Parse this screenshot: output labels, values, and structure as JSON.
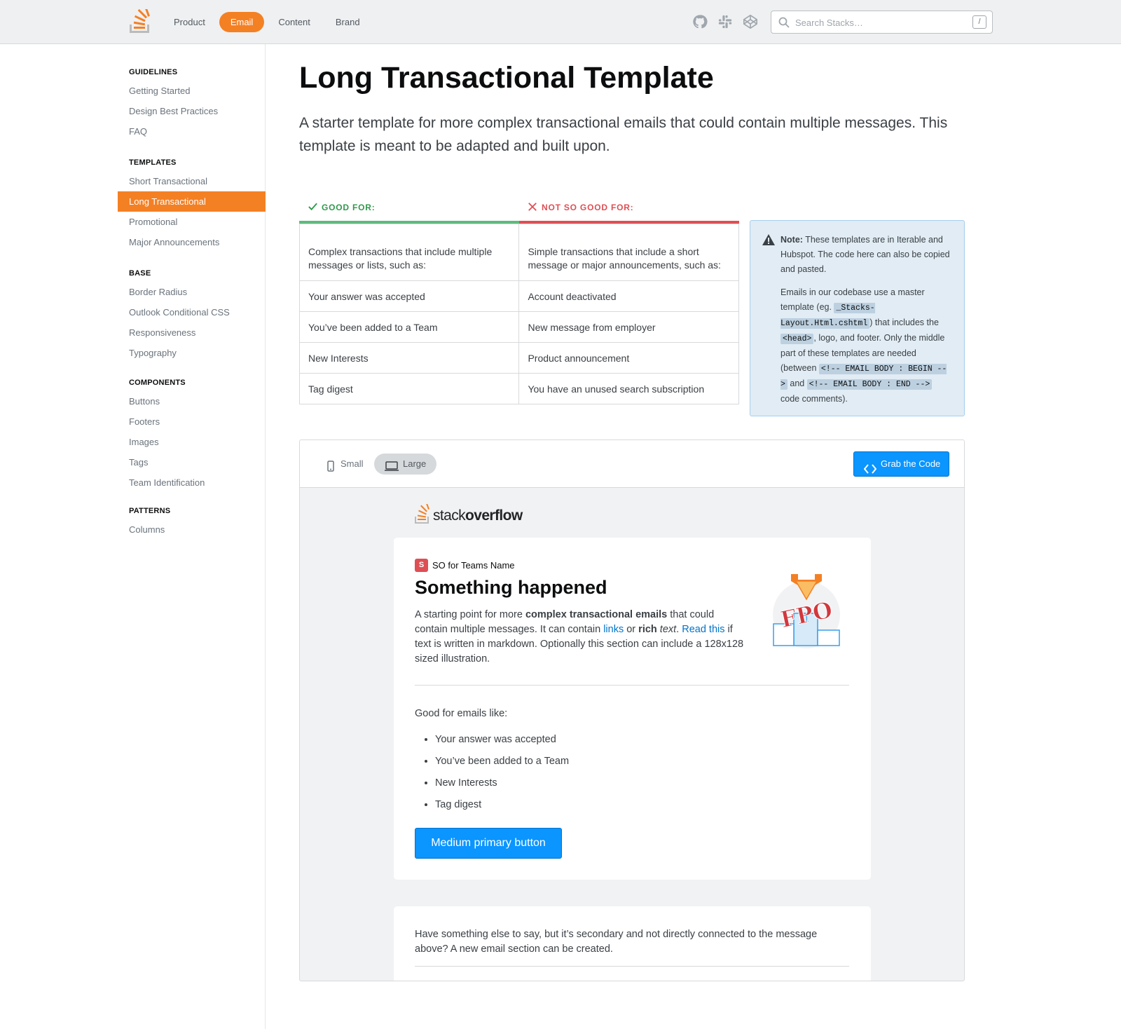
{
  "topbar": {
    "nav": [
      "Product",
      "Email",
      "Content",
      "Brand"
    ],
    "active_nav": "Email",
    "icons": [
      "github-icon",
      "slack-icon",
      "codepen-icon"
    ],
    "search_placeholder": "Search Stacks…",
    "search_shortcut": "/",
    "accent": "#f48024"
  },
  "sidebar": {
    "sections": [
      {
        "heading": "GUIDELINES",
        "items": [
          "Getting Started",
          "Design Best Practices",
          "FAQ"
        ]
      },
      {
        "heading": "TEMPLATES",
        "items": [
          "Short Transactional",
          "Long Transactional",
          "Promotional",
          "Major Announcements"
        ]
      },
      {
        "heading": "BASE",
        "items": [
          "Border Radius",
          "Outlook Conditional CSS",
          "Responsiveness",
          "Typography"
        ]
      },
      {
        "heading": "COMPONENTS",
        "items": [
          "Buttons",
          "Footers",
          "Images",
          "Tags",
          "Team Identification"
        ]
      },
      {
        "heading": "PATTERNS",
        "items": [
          "Columns"
        ]
      }
    ],
    "active_item": "Long Transactional"
  },
  "main": {
    "title": "Long Transactional Template",
    "lede": "A starter template for more complex transactional emails that could contain multiple messages. This template is meant to be adapted and built upon.",
    "good_for": {
      "label": "GOOD FOR:",
      "intro": "Complex transactions that include multiple messages or lists, such as:",
      "items": [
        "Your answer was accepted",
        "You’ve been added to a Team",
        "New Interests",
        "Tag digest"
      ]
    },
    "not_good_for": {
      "label": "NOT SO GOOD FOR:",
      "intro": "Simple transactions that include a short message or major announcements, such as:",
      "items": [
        "Account deactivated",
        "New message from employer",
        "Product announcement",
        "You have an unused search subscription"
      ]
    },
    "note": {
      "label": "Note:",
      "p1": "These templates are in Iterable and Hubspot. The code here can also be copied and pasted.",
      "p2_a": "Emails in our codebase use a master template (eg. ",
      "code1": "_Stacks-Layout.Html.cshtml",
      "p2_b": ") that includes the ",
      "code2": "<head>",
      "p2_c": ", logo, and footer. Only the middle part of these templates are needed (between ",
      "code3": "<!-- EMAIL BODY : BEGIN -->",
      "p2_d": " and ",
      "code4": "<!-- EMAIL BODY : END -->",
      "p2_e": " code comments)."
    }
  },
  "preview": {
    "size_small": "Small",
    "size_large": "Large",
    "active_size": "Large",
    "grab_code": "Grab the Code",
    "logo_word_light": "stack",
    "logo_word_bold": "overflow",
    "team_badge": "S",
    "team_name": "SO for Teams Name",
    "heading": "Something happened",
    "body": {
      "t1": "A starting point for more ",
      "b1": "complex transactional emails",
      "t2": " that could contain multiple messages. It can contain ",
      "link1": "links",
      "t3": " or ",
      "b2": "rich",
      "t4": " ",
      "i1": "text",
      "t5": ". ",
      "link2": "Read this",
      "t6": " if text is written in markdown. Optionally this section can include a 128x128 sized illustration."
    },
    "illustration_label": "FPO",
    "good_for_emails_label": "Good for emails like:",
    "good_for_emails": [
      "Your answer was accepted",
      "You’ve been added to a Team",
      "New Interests",
      "Tag digest"
    ],
    "primary_button": "Medium primary button",
    "secondary_text": "Have something else to say, but it’s secondary and not directly connected to the message above? A new email section can be created."
  }
}
